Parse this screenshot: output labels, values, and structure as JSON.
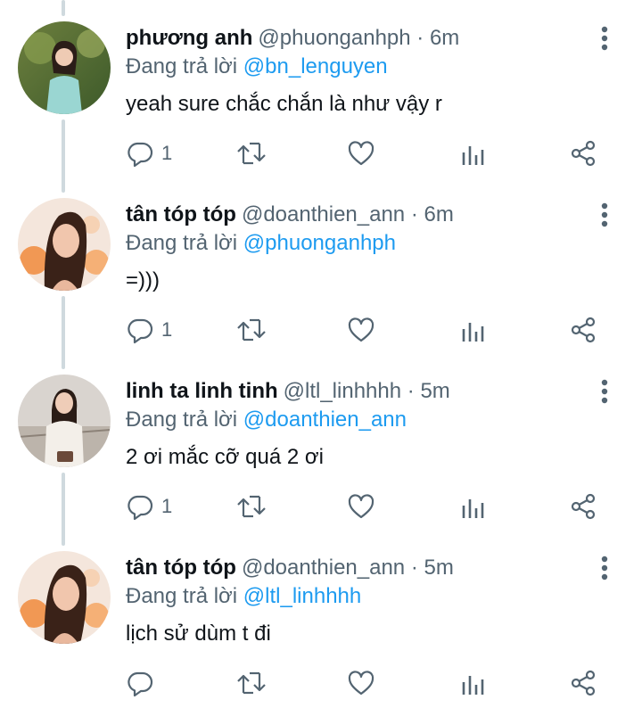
{
  "icons": {
    "reply": "reply-icon",
    "retweet": "retweet-icon",
    "like": "heart-icon",
    "analytics": "analytics-icon",
    "share": "share-icon",
    "more": "more-vertical-icon"
  },
  "colors": {
    "text": "#0f1419",
    "secondary": "#536471",
    "link": "#1d9bf0",
    "thread_line": "#cfd9de"
  },
  "tweets": [
    {
      "name": "phương anh",
      "handle": "@phuonganhph",
      "dot": "·",
      "time": "6m",
      "reply_prefix": "Đang trả lời",
      "reply_to": "@bn_lenguyen",
      "text": "yeah sure chắc chắn là như vậy r",
      "reply_count": "1"
    },
    {
      "name": "tân tóp tóp",
      "handle": "@doanthien_ann",
      "dot": "·",
      "time": "6m",
      "reply_prefix": "Đang trả lời",
      "reply_to": "@phuonganhph",
      "text": "=)))",
      "reply_count": "1"
    },
    {
      "name": "linh ta linh tinh",
      "handle": "@ltl_linhhhh",
      "dot": "·",
      "time": "5m",
      "reply_prefix": "Đang trả lời",
      "reply_to": "@doanthien_ann",
      "text": "2 ơi mắc cỡ quá 2 ơi",
      "reply_count": "1"
    },
    {
      "name": "tân tóp tóp",
      "handle": "@doanthien_ann",
      "dot": "·",
      "time": "5m",
      "reply_prefix": "Đang trả lời",
      "reply_to": "@ltl_linhhhh",
      "text": "lịch sử dùm t đi",
      "reply_count": ""
    }
  ]
}
